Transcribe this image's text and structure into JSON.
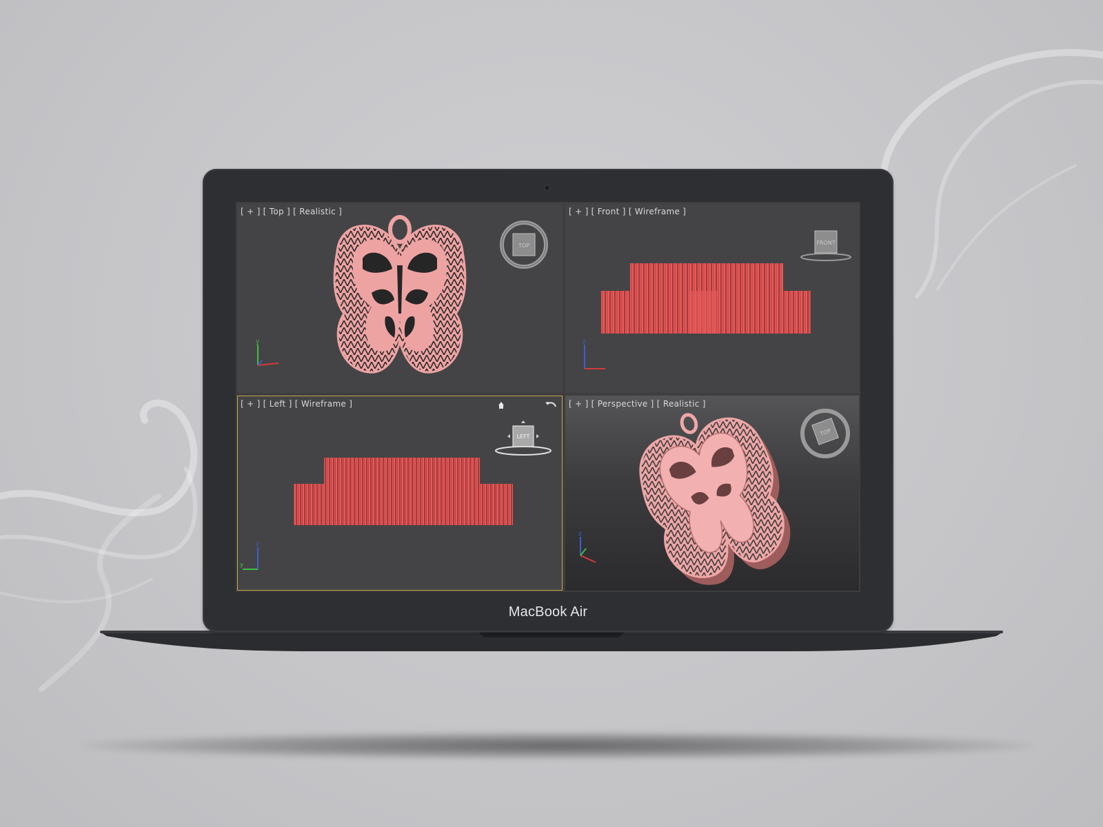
{
  "device": {
    "brand_label": "MacBook Air"
  },
  "viewports": [
    {
      "id": "top",
      "label": "[ + ] [ Top ] [ Realistic ]",
      "view": "Top",
      "shading": "Realistic",
      "active": false,
      "view_cube_label": "TOP"
    },
    {
      "id": "front",
      "label": "[ + ] [ Front ] [ Wireframe ]",
      "view": "Front",
      "shading": "Wireframe",
      "active": false,
      "view_cube_label": "FRONT"
    },
    {
      "id": "left",
      "label": "[ + ] [ Left ] [ Wireframe ]",
      "view": "Left",
      "shading": "Wireframe",
      "active": true,
      "view_cube_label": "LEFT"
    },
    {
      "id": "perspective",
      "label": "[ + ] [ Perspective ] [ Realistic ]",
      "view": "Perspective",
      "shading": "Realistic",
      "active": false,
      "view_cube_label": "TOP"
    }
  ],
  "axis_labels": {
    "x": "x",
    "y": "y",
    "z": "z"
  },
  "colors": {
    "model_pink": "#eea3a3",
    "wire_red": "#e85a5a",
    "viewport_bg": "#444446",
    "active_border": "#c9a645",
    "axis_x": "#d23b3b",
    "axis_y": "#3fbf3f",
    "axis_z": "#3b5fd2"
  },
  "icons": [
    "home-icon",
    "undo-arrow-icon",
    "view-cube-icon",
    "axis-tripod-icon",
    "camera-icon"
  ]
}
